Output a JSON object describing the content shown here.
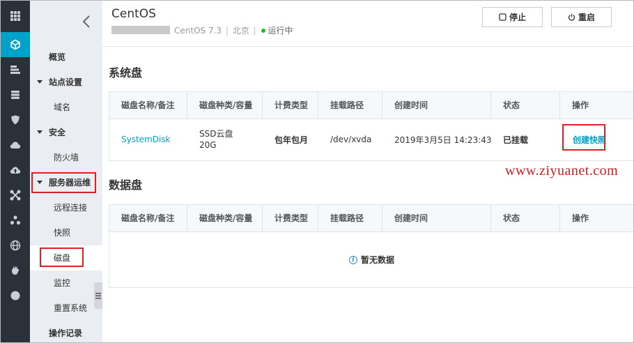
{
  "rail": {
    "icons": [
      "grid-icon",
      "cube-icon",
      "server-stack-icon",
      "database-icon",
      "shield-icon",
      "cloud-icon",
      "cloud-upload-icon",
      "network-cross-icon",
      "cluster-icon",
      "globe-icon",
      "hand-icon",
      "circle-icon"
    ],
    "active_index": 1,
    "active_color": "#00a2ca"
  },
  "menu": {
    "items": [
      {
        "label": "概览",
        "level": 0
      },
      {
        "label": "站点设置",
        "level": 0
      },
      {
        "label": "域名",
        "level": 1
      },
      {
        "label": "安全",
        "level": 0
      },
      {
        "label": "防火墙",
        "level": 1
      },
      {
        "label": "服务器运维",
        "level": 0
      },
      {
        "label": "远程连接",
        "level": 1
      },
      {
        "label": "快照",
        "level": 1
      },
      {
        "label": "磁盘",
        "level": 1
      },
      {
        "label": "监控",
        "level": 1
      },
      {
        "label": "重置系统",
        "level": 1
      },
      {
        "label": "操作记录",
        "level": 0
      }
    ],
    "selected": "磁盘"
  },
  "header": {
    "title": "CentOS",
    "os": "CentOS 7.3",
    "region": "北京",
    "status": "运行中",
    "status_color": "#1dc11d",
    "stop_label": "停止",
    "restart_label": "重启"
  },
  "system_disk": {
    "title": "系统盘",
    "columns": [
      "磁盘名称/备注",
      "磁盘种类/容量",
      "计费类型",
      "挂载路径",
      "创建时间",
      "状态",
      "操作"
    ],
    "rows": [
      {
        "name": "SystemDisk",
        "type": "SSD云盘",
        "capacity": "20G",
        "billing": "包年包月",
        "mount": "/dev/xvda",
        "created": "2019年3月5日 14:23:43",
        "status": "已挂载",
        "action": "创建快照"
      }
    ]
  },
  "data_disk": {
    "title": "数据盘",
    "columns": [
      "磁盘名称/备注",
      "磁盘种类/容量",
      "计费类型",
      "挂载路径",
      "创建时间",
      "状态",
      "操作"
    ],
    "empty_text": "暂无数据"
  },
  "watermark": "www.ziyuanet.com"
}
